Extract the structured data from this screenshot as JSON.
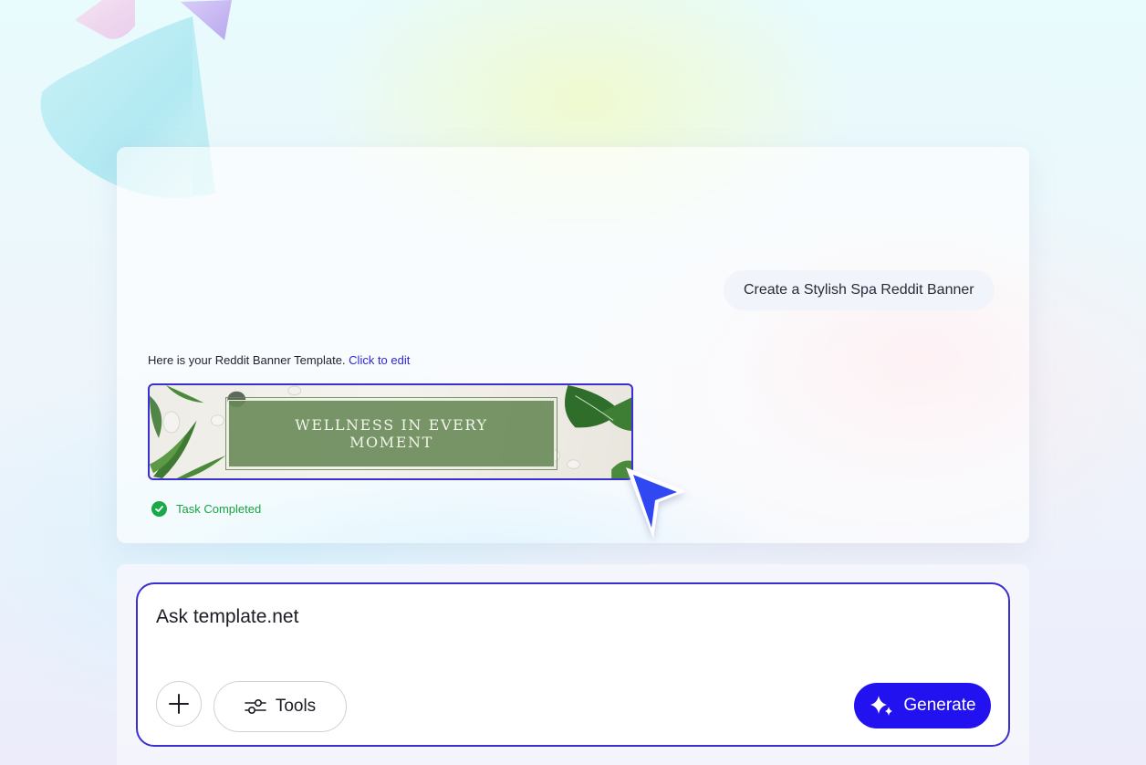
{
  "chat": {
    "user_message": "Create a Stylish Spa Reddit Banner",
    "reply_text": "Here is your Reddit Banner Template.",
    "reply_link": "Click to edit",
    "banner_title": "WELLNESS IN EVERY MOMENT",
    "status": "Task Completed"
  },
  "composer": {
    "placeholder": "Ask template.net",
    "add_icon": "plus-icon",
    "tools_label": "Tools",
    "tools_icon": "sliders-icon",
    "generate_label": "Generate",
    "generate_icon": "sparkle-icon"
  },
  "colors": {
    "accent": "#2212f0",
    "border": "#3a2fd3",
    "success": "#1aa849",
    "banner_green": "#688958"
  }
}
